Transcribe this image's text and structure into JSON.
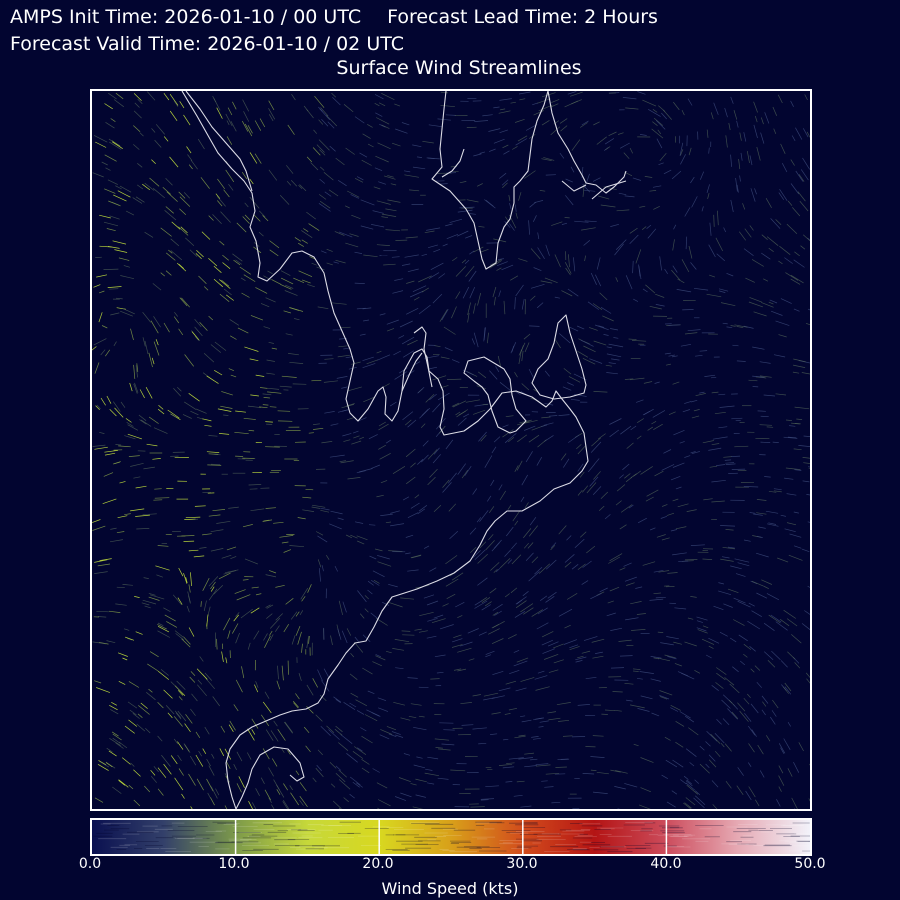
{
  "header": {
    "init_time": "AMPS Init Time: 2026-01-10 / 00 UTC",
    "lead_time": "Forecast Lead Time: 2 Hours",
    "valid_time": "Forecast Valid Time: 2026-01-10 / 02 UTC"
  },
  "plot": {
    "title": "Surface Wind Streamlines"
  },
  "colorbar": {
    "label": "Wind Speed (kts)",
    "ticks": [
      "0.0",
      "10.0",
      "20.0",
      "30.0",
      "40.0",
      "50.0"
    ],
    "range": [
      0,
      50
    ],
    "colors": [
      "#0a1050",
      "#33406a",
      "#7d9a4a",
      "#c6d83a",
      "#d8d820",
      "#d8a01a",
      "#d24c1c",
      "#b41414",
      "#cc4c5c",
      "#e6aab4",
      "#f2f2fa"
    ]
  },
  "colors": {
    "background": "#020530",
    "coastline": "#dcdce6",
    "frame": "#ffffff"
  }
}
